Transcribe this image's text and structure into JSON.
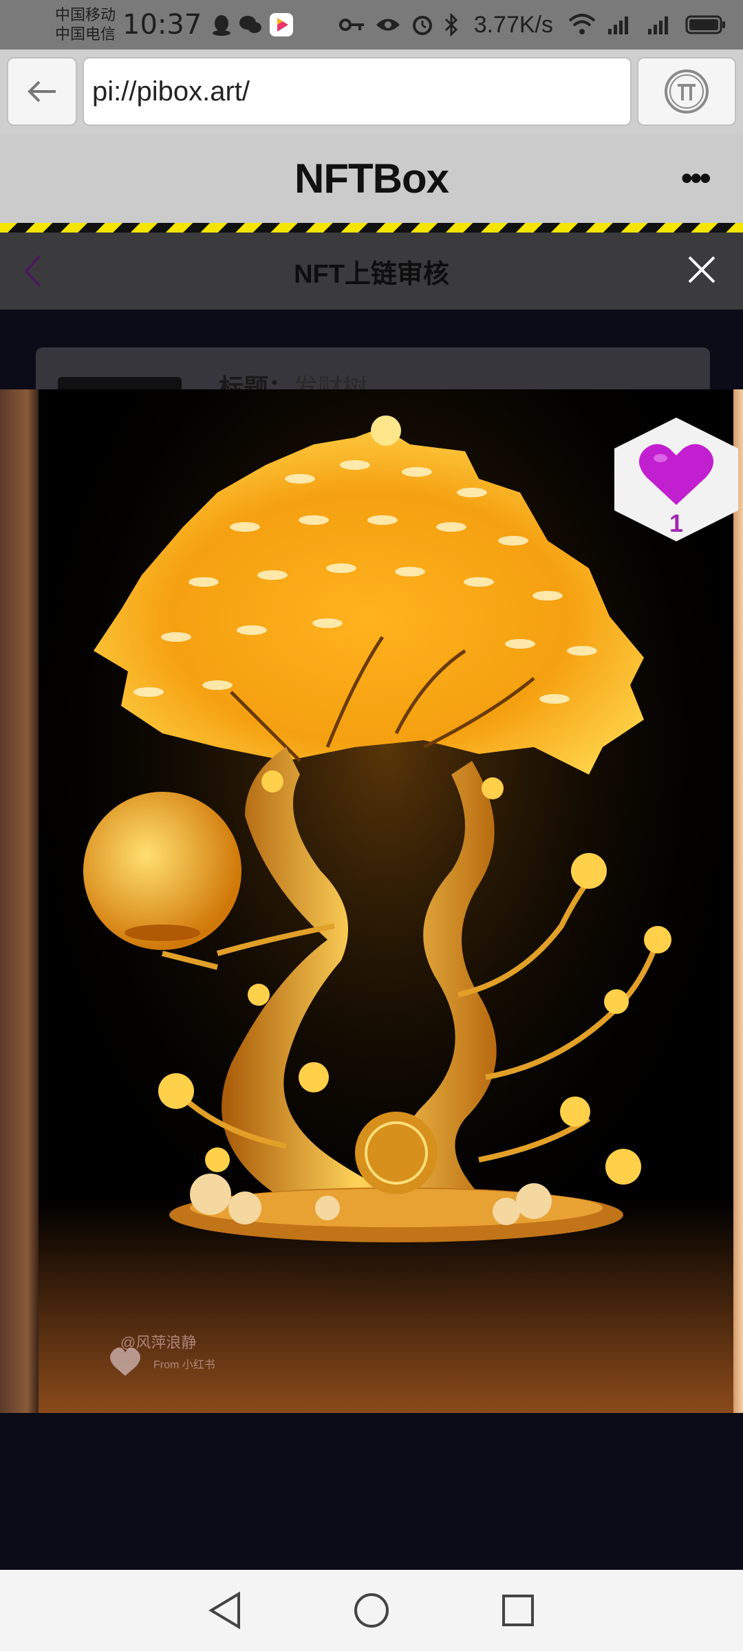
{
  "status_bar": {
    "carrier_1": "中国移动",
    "carrier_2": "中国电信",
    "time": "10:37",
    "net_speed": "3.77K/s",
    "icons": [
      "qq-icon",
      "wechat-icon",
      "video-app-icon",
      "key-icon",
      "eye-icon",
      "alarm-icon",
      "bluetooth-icon",
      "wifi-icon",
      "signal-5g-icon",
      "signal-4g-icon",
      "battery-icon"
    ]
  },
  "browser": {
    "url": "pi://pibox.art/",
    "back_icon": "arrow-left-icon",
    "pi_icon": "pi-logo-icon"
  },
  "app_header": {
    "title": "NFTBox",
    "more_label": "•••"
  },
  "modal": {
    "title": "NFT上链审核",
    "back_icon": "chevron-left-icon",
    "close_icon": "close-icon"
  },
  "card": {
    "title_label": "标题：",
    "title_value": "发财树"
  },
  "viewer": {
    "watermark_line1": "@风萍浪静",
    "watermark_line2": "From 小红书",
    "like_count": "1",
    "colors": {
      "gold": "#f5b21a",
      "heart": "#c21fd0"
    }
  },
  "nav_bar": {
    "icons": [
      "back-triangle-icon",
      "home-circle-icon",
      "recents-square-icon"
    ]
  }
}
